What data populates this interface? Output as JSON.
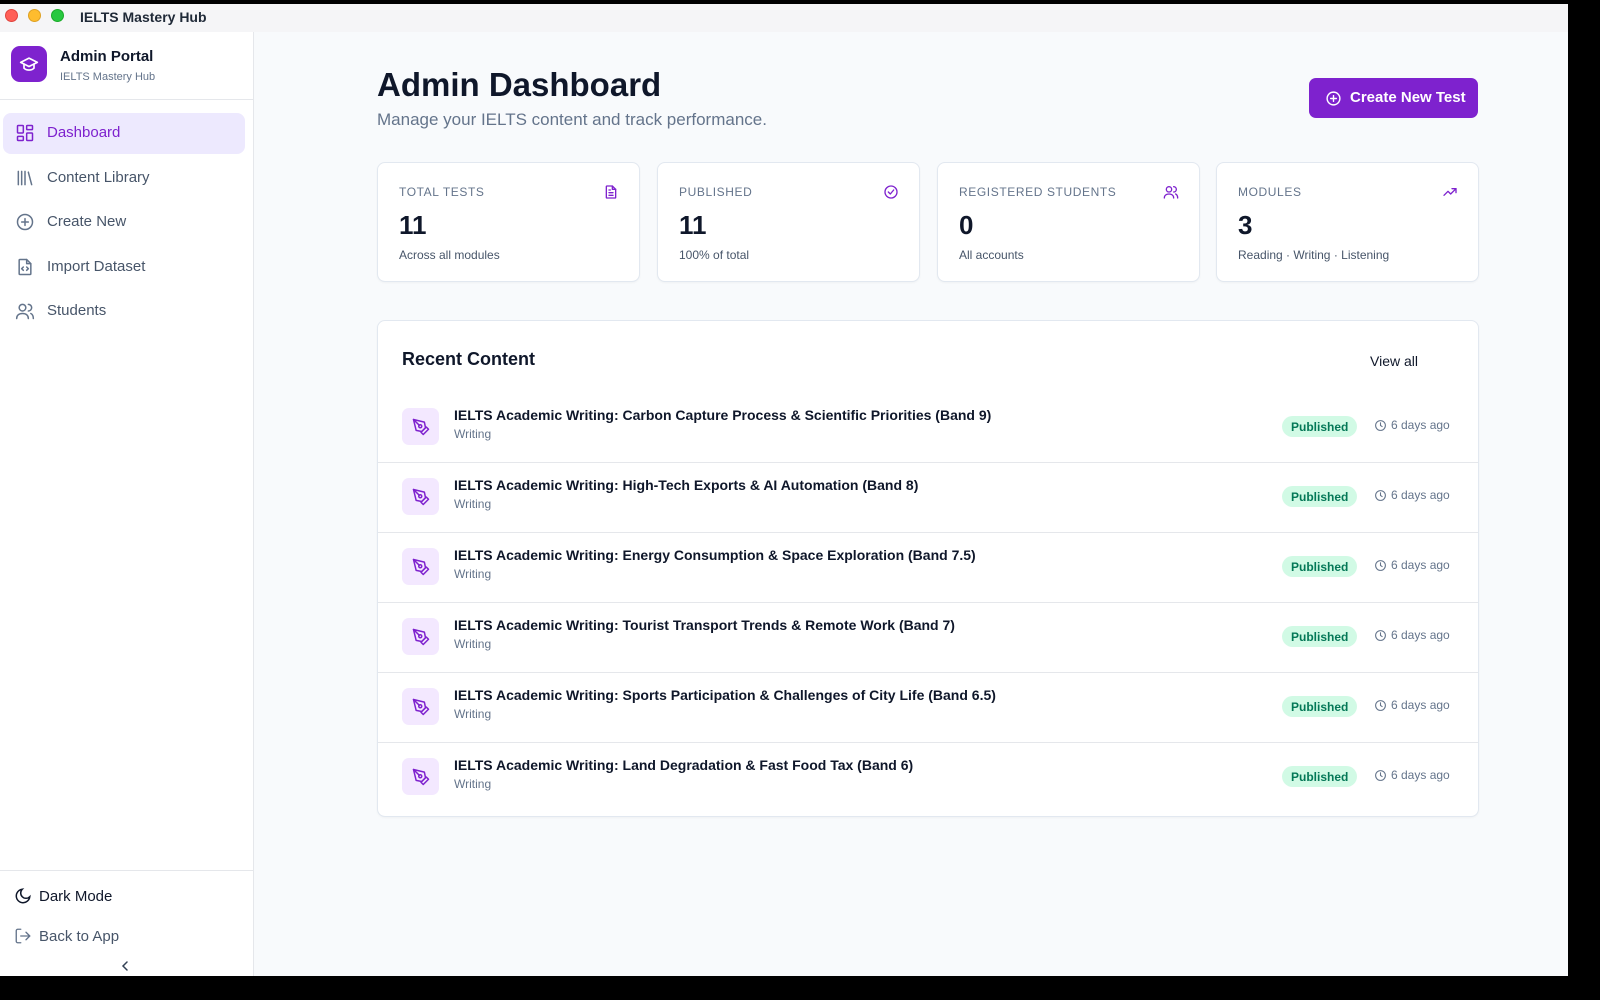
{
  "window": {
    "title": "IELTS Mastery Hub"
  },
  "brand": {
    "title": "Admin Portal",
    "subtitle": "IELTS Mastery Hub"
  },
  "sidebar": {
    "items": [
      {
        "label": "Dashboard",
        "icon": "dashboard-icon",
        "active": true
      },
      {
        "label": "Content Library",
        "icon": "library-icon",
        "active": false
      },
      {
        "label": "Create New",
        "icon": "plus-circle-icon",
        "active": false
      },
      {
        "label": "Import Dataset",
        "icon": "file-code-icon",
        "active": false
      },
      {
        "label": "Students",
        "icon": "users-icon",
        "active": false
      }
    ],
    "dark_mode_label": "Dark Mode",
    "back_label": "Back to App"
  },
  "header": {
    "title": "Admin Dashboard",
    "subtitle": "Manage your IELTS content and track performance.",
    "create_button_label": "Create New Test"
  },
  "stats": [
    {
      "label": "TOTAL TESTS",
      "value": "11",
      "note": "Across all modules",
      "icon": "document-icon"
    },
    {
      "label": "PUBLISHED",
      "value": "11",
      "note": "100% of total",
      "icon": "check-circle-icon"
    },
    {
      "label": "REGISTERED STUDENTS",
      "value": "0",
      "note": "All accounts",
      "icon": "users-icon"
    },
    {
      "label": "MODULES",
      "value": "3",
      "note": "Reading · Writing · Listening",
      "icon": "trending-up-icon"
    }
  ],
  "recent": {
    "title": "Recent Content",
    "view_all_label": "View all",
    "items": [
      {
        "title": "IELTS Academic Writing: Carbon Capture Process & Scientific Priorities (Band 9)",
        "module": "Writing",
        "status": "Published",
        "time": "6 days ago"
      },
      {
        "title": "IELTS Academic Writing: High-Tech Exports & AI Automation (Band 8)",
        "module": "Writing",
        "status": "Published",
        "time": "6 days ago"
      },
      {
        "title": "IELTS Academic Writing: Energy Consumption & Space Exploration (Band 7.5)",
        "module": "Writing",
        "status": "Published",
        "time": "6 days ago"
      },
      {
        "title": "IELTS Academic Writing: Tourist Transport Trends & Remote Work (Band 7)",
        "module": "Writing",
        "status": "Published",
        "time": "6 days ago"
      },
      {
        "title": "IELTS Academic Writing: Sports Participation & Challenges of City Life (Band 6.5)",
        "module": "Writing",
        "status": "Published",
        "time": "6 days ago"
      },
      {
        "title": "IELTS Academic Writing: Land Degradation & Fast Food Tax (Band 6)",
        "module": "Writing",
        "status": "Published",
        "time": "6 days ago"
      }
    ]
  },
  "colors": {
    "accent": "#7e22ce",
    "accent_soft": "#ede9fe",
    "success_bg": "#d1fae5",
    "success_text": "#047857"
  }
}
